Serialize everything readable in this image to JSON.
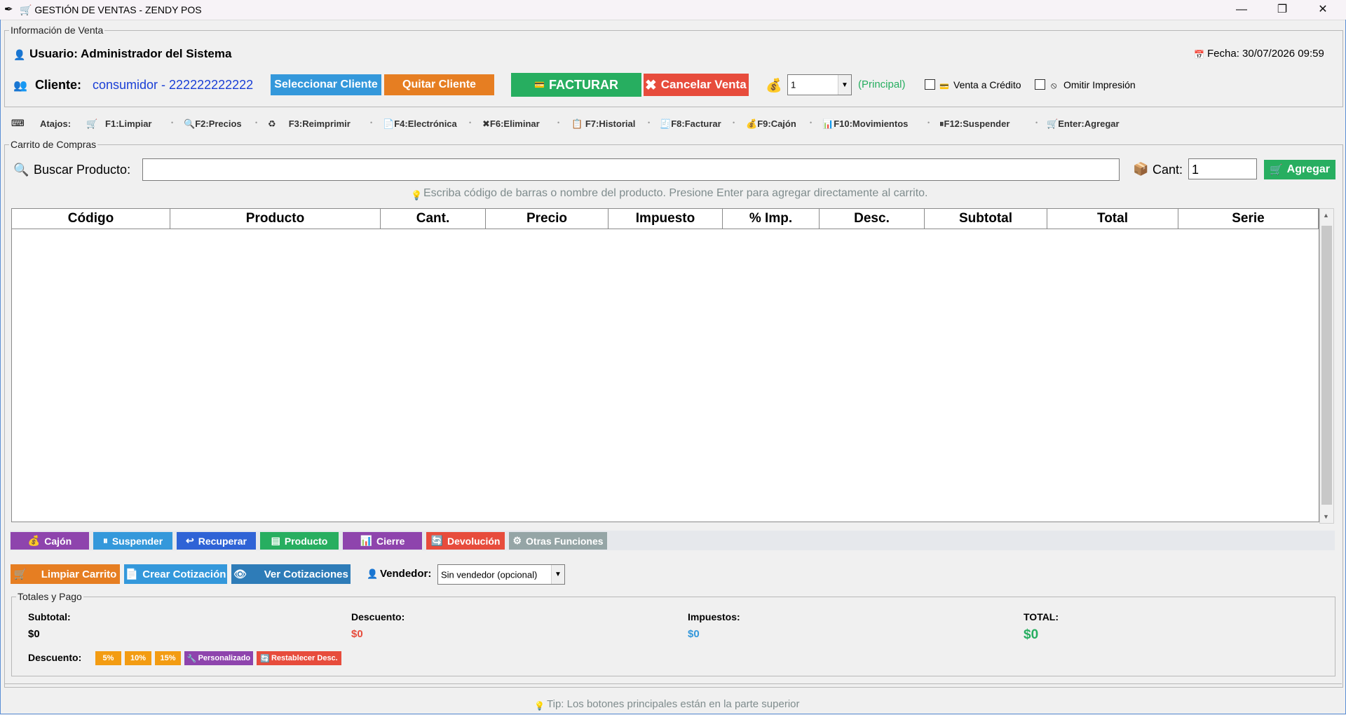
{
  "window": {
    "title": "🛒 GESTIÓN DE VENTAS - ZENDY POS",
    "minimize": "—",
    "maximize": "❐",
    "close": "✕"
  },
  "info": {
    "legend": "Información de Venta",
    "user_label": "Usuario: Administrador del Sistema",
    "date_label": "Fecha: 30/07/2026 09:59",
    "client_label": "Cliente:",
    "client_value": "consumidor - 222222222222",
    "select_client": "Seleccionar Cliente",
    "remove_client": "Quitar Cliente",
    "invoice": "FACTURAR",
    "cancel_sale": "Cancelar Venta",
    "register_value": "1",
    "register_note": "(Principal)",
    "credit_sale": "Venta a Crédito",
    "omit_print": "Omitir Impresión"
  },
  "shortcuts": {
    "label": "Atajos:",
    "items": [
      "F1:Limpiar",
      "F2:Precios",
      "F3:Reimprimir",
      "F4:Electrónica",
      "F6:Eliminar",
      "F7:Historial",
      "F8:Facturar",
      "F9:Cajón",
      "F10:Movimientos",
      "F12:Suspender",
      "Enter:Agregar"
    ]
  },
  "cart": {
    "legend": "Carrito de Compras",
    "search_label": "Buscar Producto:",
    "search_value": "",
    "qty_label": "Cant:",
    "qty_value": "1",
    "add_button": "Agregar",
    "hint": "Escriba código de barras o nombre del producto. Presione Enter para agregar directamente al carrito.",
    "columns": [
      "Código",
      "Producto",
      "Cant.",
      "Precio",
      "Impuesto",
      "% Imp.",
      "Desc.",
      "Subtotal",
      "Total",
      "Serie"
    ]
  },
  "tools": {
    "drawer": "Cajón",
    "suspend": "Suspender",
    "recover": "Recuperar",
    "product": "Producto",
    "close": "Cierre",
    "return": "Devolución",
    "other": "Otras Funciones"
  },
  "actions": {
    "clear_cart": "Limpiar Carrito",
    "create_quote": "Crear Cotización",
    "view_quotes": "Ver Cotizaciones",
    "seller_label": "Vendedor:",
    "seller_value": "Sin vendedor (opcional)"
  },
  "totals": {
    "legend": "Totales y Pago",
    "subtotal_label": "Subtotal:",
    "subtotal_value": "$0",
    "discount_label": "Descuento:",
    "discount_value": "$0",
    "tax_label": "Impuestos:",
    "tax_value": "$0",
    "total_label": "TOTAL:",
    "total_value": "$0",
    "discount_row_label": "Descuento:",
    "d5": "5%",
    "d10": "10%",
    "d15": "15%",
    "custom": "Personalizado",
    "reset": "Restablecer Desc."
  },
  "footer": {
    "tip": "Tip: Los botones principales están en la parte superior"
  },
  "colors": {
    "blue": "#3498db",
    "orange": "#e67e22",
    "green": "#27ae60",
    "red": "#e74c3c",
    "purple": "#8e44ad"
  }
}
